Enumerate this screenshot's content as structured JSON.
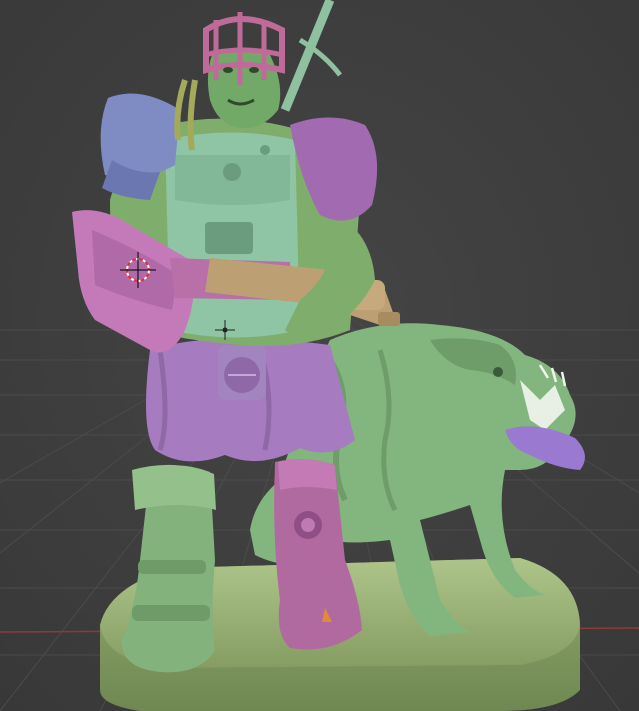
{
  "viewport": {
    "editor": "3D Viewport",
    "mode": "sculpt-preview",
    "background_color": "#3d3d3d",
    "grid_color": "#4a4a4a",
    "x_axis_color": "#8b3a3a"
  },
  "scene": {
    "subject": "orc-warrior-with-hound-miniature",
    "material_colors": {
      "skin": "#7fae6c",
      "armor": "#8fc0a0",
      "purple": "#a06aa6",
      "pink": "#c06a9a",
      "blue": "#7a86c0",
      "gun": "#b8996f",
      "base": "#9eb57c",
      "tongue": "#9a7ad0"
    }
  },
  "overlays": {
    "cursor_3d": "3d-cursor-icon",
    "object_origin": "origin-dot-icon"
  }
}
